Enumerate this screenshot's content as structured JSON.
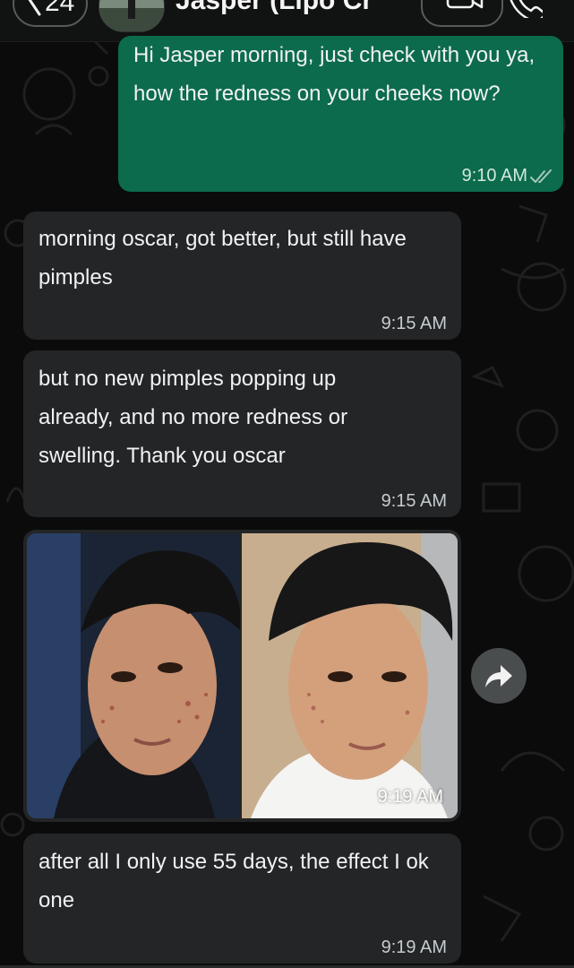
{
  "header": {
    "back_count": "24",
    "contact_name": "Jasper (Lipo Cr",
    "icons": [
      "chevron-left-icon",
      "video-call-icon",
      "phone-icon"
    ]
  },
  "messages": [
    {
      "direction": "out",
      "text": "Hi Jasper morning, just check with you ya, how the redness on your cheeks now?",
      "time": "9:10 AM",
      "status": "read"
    },
    {
      "direction": "in",
      "text": "morning oscar, got better, but still have pimples",
      "time": "9:15 AM"
    },
    {
      "direction": "in",
      "text": "but no new pimples popping up already, and no more redness or swelling. Thank you oscar",
      "time": "9:15 AM"
    },
    {
      "direction": "in",
      "type": "image",
      "time": "9:19 AM"
    },
    {
      "direction": "in",
      "text": "after all I only use 55 days, the effect I ok one",
      "time": "9:19 AM"
    }
  ],
  "colors": {
    "background": "#0b0b0b",
    "incoming_bubble": "#232526",
    "outgoing_bubble": "#0c6b4c"
  }
}
